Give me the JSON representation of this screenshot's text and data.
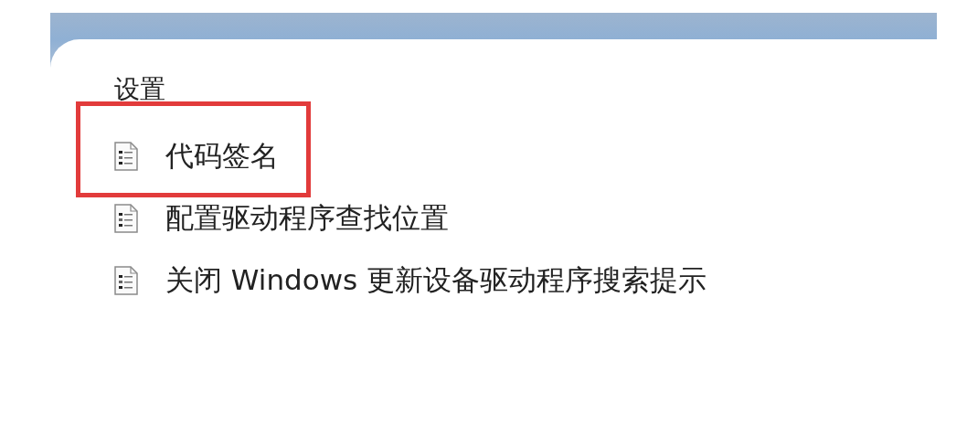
{
  "section": {
    "heading": "设置"
  },
  "policies": [
    {
      "label": "代码签名",
      "highlighted": true
    },
    {
      "label": "配置驱动程序查找位置",
      "highlighted": false
    },
    {
      "label": "关闭 Windows 更新设备驱动程序搜索提示",
      "highlighted": false
    }
  ]
}
